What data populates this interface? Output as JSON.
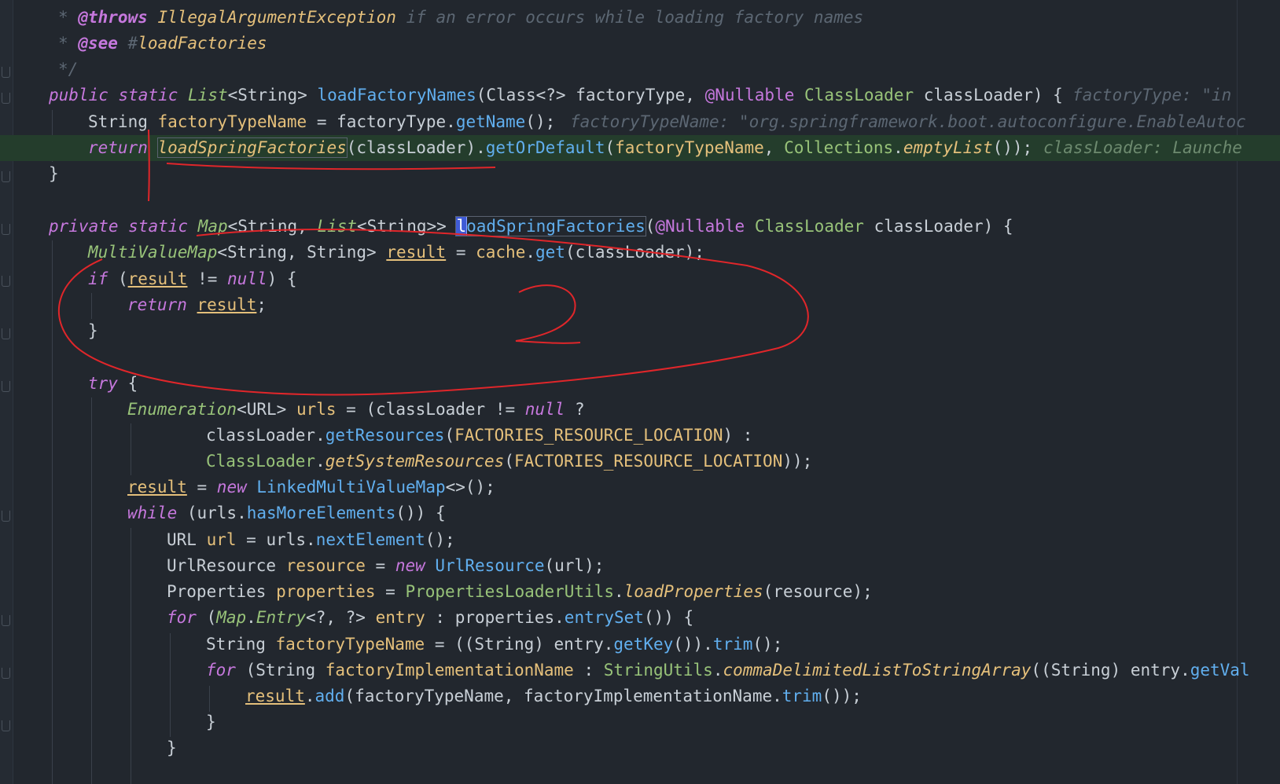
{
  "editor": {
    "lines": {
      "l0": {
        "star": "* ",
        "tag": "@throws",
        "type": "IllegalArgumentException",
        "desc": "if an error occurs while loading factory names"
      },
      "l1": {
        "star": "* ",
        "tag": "@see",
        "hash": "#",
        "ref": "loadFactories"
      },
      "l2": {
        "end": "*/"
      },
      "l3": {
        "kw1": "public",
        "kw2": "static",
        "ret": "List",
        "lt": "<",
        "str": "String",
        "gt": ">",
        "name": "loadFactoryNames",
        "open": "(",
        "cls": "Class",
        "gen": "<?>",
        "p1": "factoryType,",
        "ann": "@Nullable",
        "cl": "ClassLoader",
        "p2": "classLoader) {",
        "hint": "factoryType: \"in"
      },
      "l4": {
        "ty": "String",
        "var": "factoryTypeName",
        "eq": " = factoryType.",
        "call": "getName",
        "end": "();",
        "hint": "factoryTypeName: \"org.springframework.boot.autoconfigure.EnableAutoc"
      },
      "l5": {
        "kw": "return",
        "call1": "loadSpringFactories",
        "arg": "(classLoader).",
        "call2": "getOrDefault",
        "arg2": "(",
        "var": "factoryTypeName",
        "comma": ", ",
        "cls": "Collections",
        "dot": ".",
        "call3": "emptyList",
        "end": "());",
        "hint": "classLoader: Launche"
      },
      "l6": {
        "brace": "}"
      },
      "l8": {
        "kw1": "private",
        "kw2": "static",
        "map": "Map",
        "lt": "<",
        "s1": "String",
        "c1": ", ",
        "list": "List",
        "lt2": "<",
        "s2": "String",
        "gt": ">>",
        "cursorchar": "l",
        "name": "oadSpringFactories",
        "open": "(",
        "ann": "@Nullable",
        "cl": "ClassLoader",
        "rest": "classLoader) {"
      },
      "l9": {
        "ty": "MultiValueMap",
        "gen": "<String, String>",
        "var": "result",
        "eq": " = ",
        "cache": "cache",
        "dot": ".",
        "call": "get",
        "end": "(classLoader);"
      },
      "l10": {
        "kw": "if",
        "open": " (",
        "var": "result",
        "ne": " != ",
        "null": "null",
        "end": ") {"
      },
      "l11": {
        "kw": "return",
        "var": "result",
        "end": ";"
      },
      "l12": {
        "brace": "}"
      },
      "l14": {
        "kw": "try",
        "end": " {"
      },
      "l15": {
        "ty": "Enumeration",
        "gen": "<URL>",
        "var": "urls",
        "eq": " = (classLoader != ",
        "null": "null",
        "end": " ?"
      },
      "l16": {
        "a": "classLoader.",
        "call": "getResources",
        "b": "(",
        "const": "FACTORIES_RESOURCE_LOCATION",
        "c": ") :"
      },
      "l17": {
        "cls": "ClassLoader",
        "dot": ".",
        "call": "getSystemResources",
        "b": "(",
        "const": "FACTORIES_RESOURCE_LOCATION",
        "c": "));"
      },
      "l18": {
        "var": "result",
        "eq": " = ",
        "kw": "new",
        "cls": "LinkedMultiValueMap",
        "end": "<>();"
      },
      "l19": {
        "kw": "while",
        "a": " (urls.",
        "call": "hasMoreElements",
        "end": "()) {"
      },
      "l20": {
        "ty": "URL",
        "var": "url",
        "eq": " = urls.",
        "call": "nextElement",
        "end": "();"
      },
      "l21": {
        "ty": "UrlResource",
        "var": "resource",
        "eq": " = ",
        "kw": "new",
        "cls": "UrlResource",
        "end": "(url);"
      },
      "l22": {
        "ty": "Properties",
        "var": "properties",
        "eq": " = ",
        "cls": "PropertiesLoaderUtils",
        "dot": ".",
        "call": "loadProperties",
        "end": "(resource);"
      },
      "l23": {
        "kw": "for",
        "a": " (",
        "map": "Map",
        "dot": ".",
        "entry": "Entry",
        "gen": "<?, ?>",
        "var": "entry",
        "b": " : properties.",
        "call": "entrySet",
        "end": "()) {"
      },
      "l24": {
        "ty": "String",
        "var": "factoryTypeName",
        "eq": " = ((String) entry.",
        "call": "getKey",
        "mid": "()).",
        "call2": "trim",
        "end": "();"
      },
      "l25": {
        "kw": "for",
        "a": " (String ",
        "var": "factoryImplementationName",
        "b": " : ",
        "cls": "StringUtils",
        "dot": ".",
        "call": "commaDelimitedListToStringArray",
        "c": "((String) entry.",
        "call2": "getVal"
      },
      "l26": {
        "var": "result",
        "dot": ".",
        "call": "add",
        "a": "(factoryTypeName, factoryImplementationName.",
        "call2": "trim",
        "end": "());"
      },
      "l27": {
        "brace": "}"
      },
      "l28": {
        "brace": "}"
      }
    },
    "annotations": {
      "number": "2"
    }
  }
}
